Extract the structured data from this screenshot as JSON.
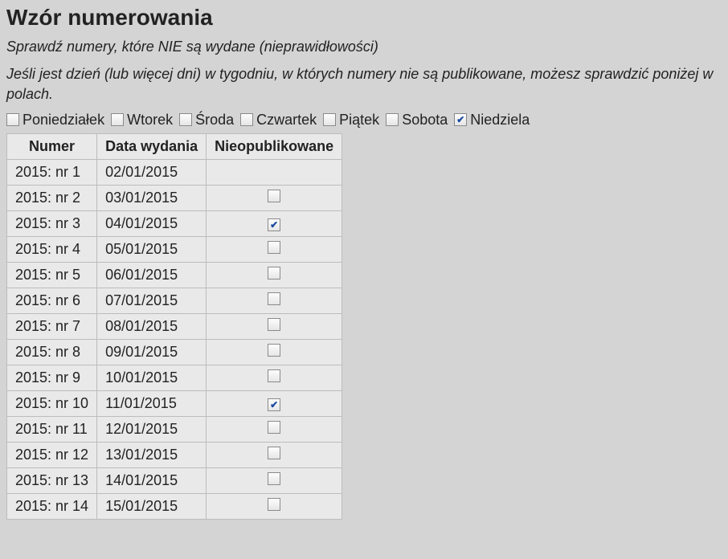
{
  "heading": "Wzór numerowania",
  "subtitle1": "Sprawdź numery, które NIE są wydane (nieprawidłowości)",
  "subtitle2": "Jeśli jest dzień (lub więcej dni) w tygodniu, w których numery nie są publikowane, możesz sprawdzić poniżej w polach.",
  "days": [
    {
      "label": "Poniedziałek",
      "checked": false
    },
    {
      "label": "Wtorek",
      "checked": false
    },
    {
      "label": "Środa",
      "checked": false
    },
    {
      "label": "Czwartek",
      "checked": false
    },
    {
      "label": "Piątek",
      "checked": false
    },
    {
      "label": "Sobota",
      "checked": false
    },
    {
      "label": "Niedziela",
      "checked": true
    }
  ],
  "table": {
    "headers": {
      "num": "Numer",
      "date": "Data wydania",
      "unpub": "Nieopublikowane"
    },
    "rows": [
      {
        "num": "2015: nr 1",
        "date": "02/01/2015",
        "checkbox": null
      },
      {
        "num": "2015: nr 2",
        "date": "03/01/2015",
        "checkbox": false
      },
      {
        "num": "2015: nr 3",
        "date": "04/01/2015",
        "checkbox": true
      },
      {
        "num": "2015: nr 4",
        "date": "05/01/2015",
        "checkbox": false
      },
      {
        "num": "2015: nr 5",
        "date": "06/01/2015",
        "checkbox": false
      },
      {
        "num": "2015: nr 6",
        "date": "07/01/2015",
        "checkbox": false
      },
      {
        "num": "2015: nr 7",
        "date": "08/01/2015",
        "checkbox": false
      },
      {
        "num": "2015: nr 8",
        "date": "09/01/2015",
        "checkbox": false
      },
      {
        "num": "2015: nr 9",
        "date": "10/01/2015",
        "checkbox": false
      },
      {
        "num": "2015: nr 10",
        "date": "11/01/2015",
        "checkbox": true
      },
      {
        "num": "2015: nr 11",
        "date": "12/01/2015",
        "checkbox": false
      },
      {
        "num": "2015: nr 12",
        "date": "13/01/2015",
        "checkbox": false
      },
      {
        "num": "2015: nr 13",
        "date": "14/01/2015",
        "checkbox": false
      },
      {
        "num": "2015: nr 14",
        "date": "15/01/2015",
        "checkbox": false
      }
    ]
  }
}
